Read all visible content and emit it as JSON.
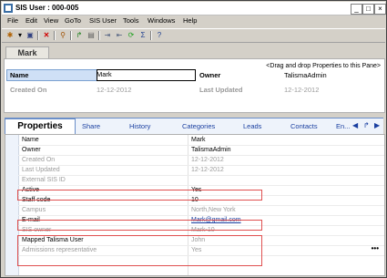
{
  "window": {
    "title": "SIS User : 000-005"
  },
  "menu": [
    "File",
    "Edit",
    "View",
    "GoTo",
    "SIS User",
    "Tools",
    "Windows",
    "Help"
  ],
  "header": {
    "tab_label": "Mark",
    "drag_hint": "<Drag and drop Properties to this Pane>",
    "name_label": "Name",
    "name_value": "Mark",
    "owner_label": "Owner",
    "owner_value": "TalismaAdmin",
    "created_label": "Created On",
    "created_value": "12-12-2012",
    "updated_label": "Last Updated",
    "updated_value": "12-12-2012"
  },
  "tabs": [
    "Properties",
    "Share",
    "History",
    "Categories",
    "Leads",
    "Contacts",
    "En..."
  ],
  "properties": [
    {
      "label": "Name",
      "value": "Mark",
      "style": "normal"
    },
    {
      "label": "Owner",
      "value": "TalismaAdmin",
      "style": "normal"
    },
    {
      "label": "Created On",
      "value": "12-12-2012",
      "style": "grey"
    },
    {
      "label": "Last Updated",
      "value": "12-12-2012",
      "style": "grey"
    },
    {
      "label": "External SIS ID",
      "value": "",
      "style": "grey"
    },
    {
      "label": "Active",
      "value": "Yes",
      "style": "normal"
    },
    {
      "label": "Staff code",
      "value": "10",
      "style": "normal"
    },
    {
      "label": "Campus",
      "value": "North,New York",
      "style": "grey"
    },
    {
      "label": "E-mail",
      "value": "Mark@gmail.com",
      "style": "link"
    },
    {
      "label": "SIS owner",
      "value": "Mark-10",
      "style": "grey"
    },
    {
      "label": "Mapped Talisma User",
      "value": "John",
      "style": "mixed"
    },
    {
      "label": "Admissions representative",
      "value": "Yes",
      "style": "grey"
    }
  ],
  "colors": {
    "titlebar": "#ffffff",
    "highlight_box": "#e05050",
    "tab_text": "#1a3fa0"
  }
}
